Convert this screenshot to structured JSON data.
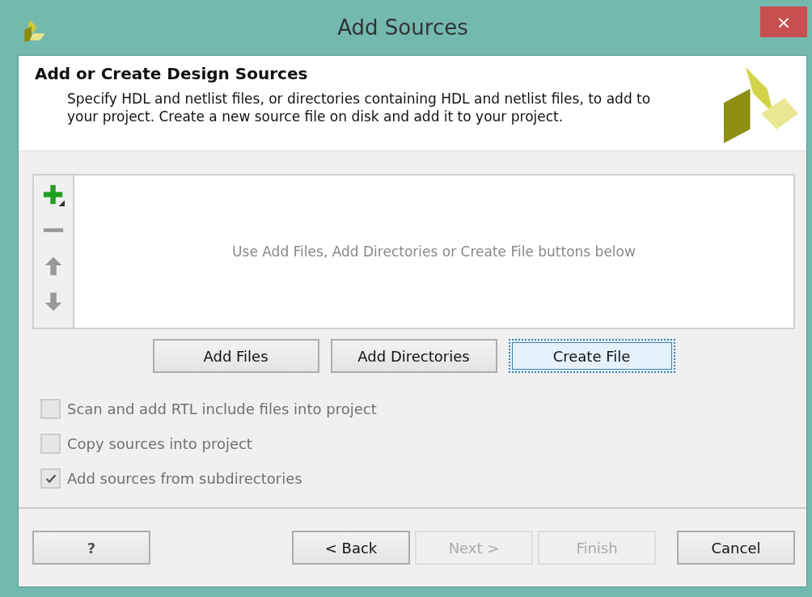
{
  "window": {
    "title": "Add Sources",
    "close": "×"
  },
  "header": {
    "title": "Add or Create Design Sources",
    "description": "Specify HDL and netlist files, or directories containing HDL and netlist files, to add to your project. Create a new source file on disk and add it to your project."
  },
  "file_list": {
    "placeholder": "Use Add Files, Add Directories or Create File buttons below"
  },
  "source_buttons": [
    {
      "label": "Add Files",
      "focused": false
    },
    {
      "label": "Add Directories",
      "focused": false
    },
    {
      "label": "Create File",
      "focused": true
    }
  ],
  "options": [
    {
      "label": "Scan and add RTL include files into project",
      "checked": false,
      "disabled": true
    },
    {
      "label": "Copy sources into project",
      "checked": false,
      "disabled": true
    },
    {
      "label": "Add sources from subdirectories",
      "checked": true,
      "disabled": true
    }
  ],
  "help_button": "?",
  "nav_buttons": [
    {
      "label": "< Back",
      "disabled": false
    },
    {
      "label": "Next >",
      "disabled": true
    },
    {
      "label": "Finish",
      "disabled": true
    },
    {
      "label": "Cancel",
      "disabled": false
    }
  ]
}
